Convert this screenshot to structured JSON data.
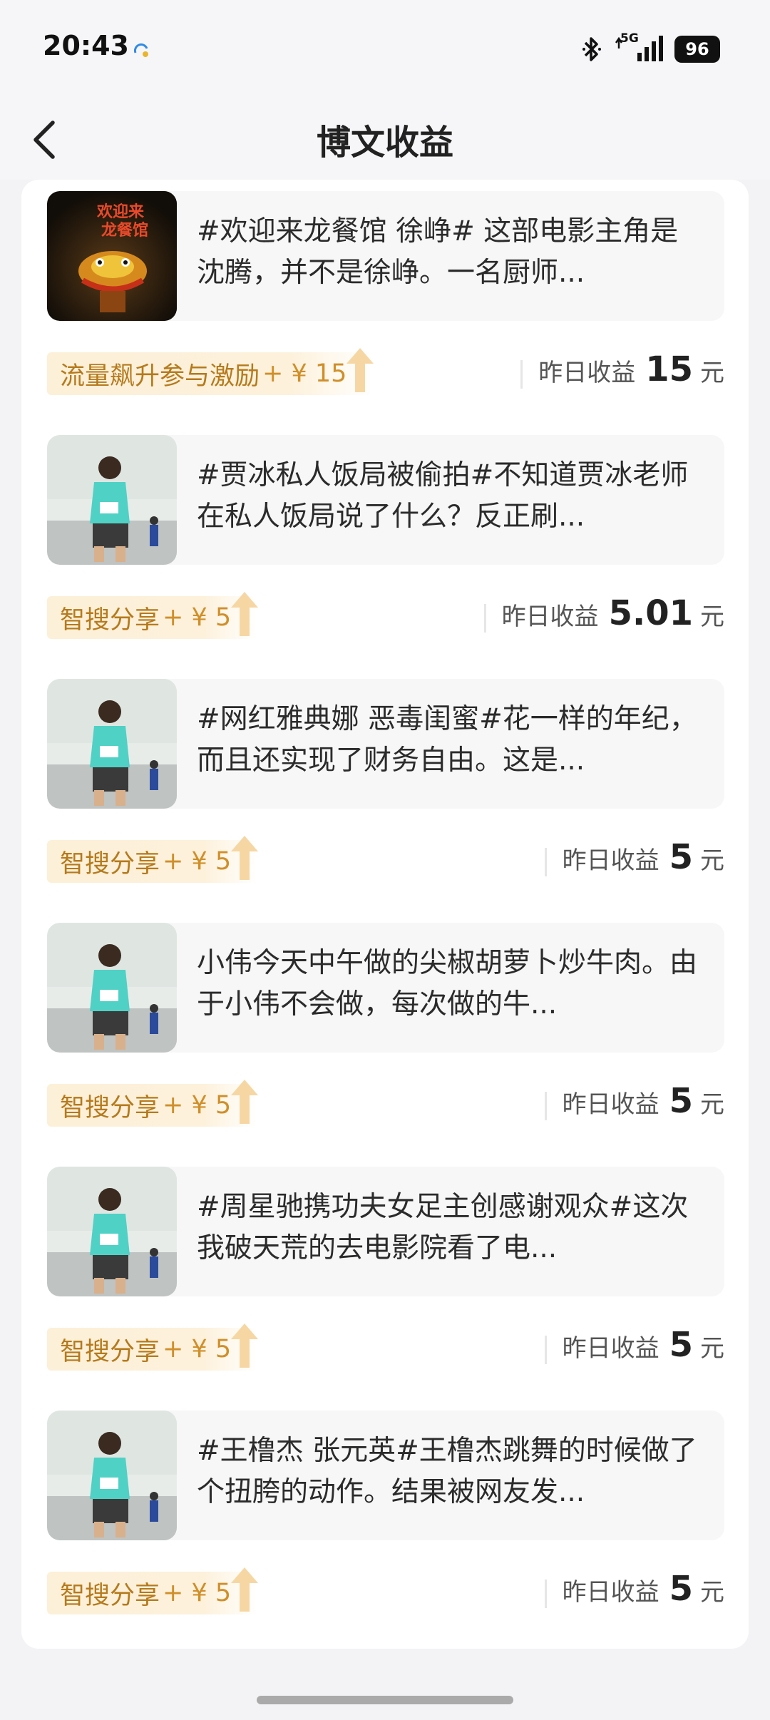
{
  "status_bar": {
    "time": "20:43",
    "network": "5G",
    "battery": "96"
  },
  "header": {
    "title": "博文收益"
  },
  "icons": {
    "back": "back-arrow-icon",
    "sync": "sync-cloud-icon",
    "bluetooth": "bluetooth-icon",
    "signal": "signal-icon",
    "reward_arrow": "up-arrow-icon"
  },
  "colors": {
    "reward_text": "#b57a1c",
    "reward_bg": "#fdf0d8",
    "page_bg": "#f3f3f5"
  },
  "items": [
    {
      "text": "#欢迎来龙餐馆 徐峥# 这部电影主角是沈腾，并不是徐峥。一名厨师...",
      "thumb": "movie-poster",
      "reward_label": "流量飙升参与激励",
      "reward_amount": "+ ¥ 15",
      "earn_label": "昨日收益",
      "earn_value": "15",
      "earn_unit": "元"
    },
    {
      "text": "#贾冰私人饭局被偷拍#不知道贾冰老师在私人饭局说了什么？反正刷...",
      "thumb": "runner-photo",
      "reward_label": "智搜分享",
      "reward_amount": "+ ¥ 5",
      "earn_label": "昨日收益",
      "earn_value": "5.01",
      "earn_unit": "元"
    },
    {
      "text": "#网红雅典娜 恶毒闺蜜#花一样的年纪，而且还实现了财务自由。这是...",
      "thumb": "runner-photo",
      "reward_label": "智搜分享",
      "reward_amount": "+ ¥ 5",
      "earn_label": "昨日收益",
      "earn_value": "5",
      "earn_unit": "元"
    },
    {
      "text": "小伟今天中午做的尖椒胡萝卜炒牛肉。由于小伟不会做，每次做的牛...",
      "thumb": "runner-photo",
      "reward_label": "智搜分享",
      "reward_amount": "+ ¥ 5",
      "earn_label": "昨日收益",
      "earn_value": "5",
      "earn_unit": "元"
    },
    {
      "text": "#周星驰携功夫女足主创感谢观众#这次我破天荒的去电影院看了电...",
      "thumb": "runner-photo",
      "reward_label": "智搜分享",
      "reward_amount": "+ ¥ 5",
      "earn_label": "昨日收益",
      "earn_value": "5",
      "earn_unit": "元"
    },
    {
      "text": "#王橹杰 张元英#王橹杰跳舞的时候做了个扭胯的动作。结果被网友发...",
      "thumb": "runner-photo",
      "reward_label": "智搜分享",
      "reward_amount": "+ ¥ 5",
      "earn_label": "昨日收益",
      "earn_value": "5",
      "earn_unit": "元"
    }
  ]
}
